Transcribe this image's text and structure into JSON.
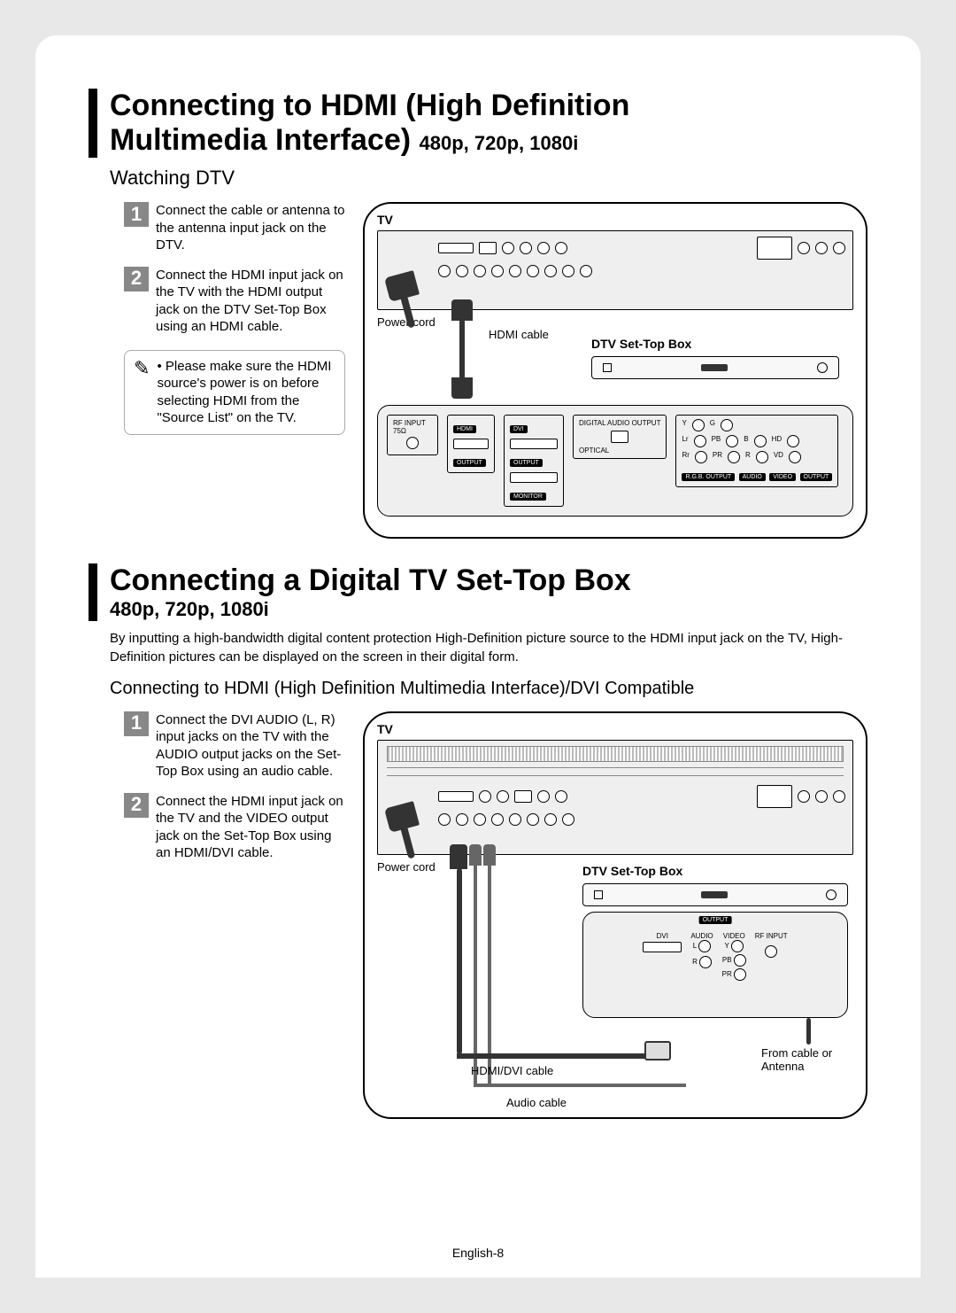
{
  "section1": {
    "title_line1": "Connecting to HDMI (High Definition",
    "title_line2": "Multimedia Interface)",
    "title_resolutions": "480p, 720p, 1080i",
    "subheading": "Watching DTV",
    "step1": "Connect the cable or antenna to the antenna input jack on the DTV.",
    "step2": "Connect the HDMI input jack on the TV with the HDMI output jack on the DTV Set-Top Box using an HDMI cable.",
    "note": "Please make sure the HDMI source's power is on before selecting HDMI from the \"Source List\" on the TV.",
    "diagram": {
      "tv_label": "TV",
      "power_cord": "Power cord",
      "hdmi_cable": "HDMI cable",
      "stb_label": "DTV Set-Top Box",
      "ports": {
        "rf_input": "RF INPUT 75Ω",
        "hdmi": "HDMI",
        "dvi": "DVI",
        "output": "OUTPUT",
        "monitor": "MONITOR",
        "digital_audio_output": "DIGITAL AUDIO OUTPUT",
        "optical": "OPTICAL",
        "rgb_output": "R.G.B. OUTPUT",
        "audio": "AUDIO",
        "video": "VIDEO",
        "component_y": "Y",
        "component_g": "G",
        "component_lr": "Lr",
        "component_pb": "PB",
        "component_b": "B",
        "component_hd": "HD",
        "component_rr": "Rr",
        "component_pr": "PR",
        "component_r": "R",
        "component_vd": "VD"
      }
    }
  },
  "section2": {
    "title": "Connecting a Digital TV Set-Top Box",
    "title_resolutions": "480p, 720p, 1080i",
    "intro": "By inputting a high-bandwidth digital content protection High-Definition picture source to the HDMI input jack on the TV, High-Definition pictures can be displayed on the screen in their digital form.",
    "subheading": "Connecting to HDMI (High Definition Multimedia Interface)/DVI Compatible",
    "step1": "Connect the DVI AUDIO (L, R) input jacks on the TV with the AUDIO output jacks on the Set-Top Box using an audio cable.",
    "step2": "Connect the HDMI input jack on the TV and the VIDEO output jack on the Set-Top Box using an HDMI/DVI cable.",
    "diagram": {
      "tv_label": "TV",
      "power_cord": "Power cord",
      "stb_label": "DTV Set-Top Box",
      "hdmi_dvi_cable": "HDMI/DVI cable",
      "audio_cable": "Audio cable",
      "from_cable": "From cable or Antenna",
      "ports": {
        "output": "OUTPUT",
        "dvi": "DVI",
        "audio": "AUDIO",
        "video": "VIDEO",
        "rf_input": "RF INPUT",
        "l": "L",
        "y": "Y",
        "r": "R",
        "pb": "PB",
        "pr": "PR"
      }
    }
  },
  "steps": {
    "one": "1",
    "two": "2"
  },
  "bullet": "•",
  "footer": "English-8"
}
